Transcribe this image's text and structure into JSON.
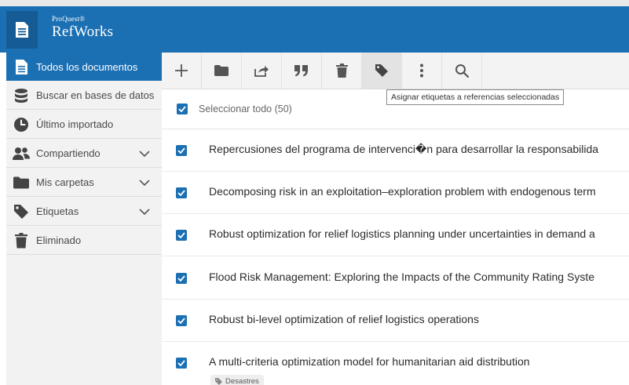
{
  "app": {
    "brand_top": "ProQuest®",
    "brand_name": "RefWorks"
  },
  "sidebar": {
    "items": [
      {
        "label": "Todos los documentos",
        "icon": "document-icon"
      },
      {
        "label": "Buscar en bases de datos",
        "icon": "database-icon"
      },
      {
        "label": "Último importado",
        "icon": "clock-icon"
      },
      {
        "label": "Compartiendo",
        "icon": "users-icon"
      },
      {
        "label": "Mis carpetas",
        "icon": "folder-icon"
      },
      {
        "label": "Etiquetas",
        "icon": "tag-icon"
      },
      {
        "label": "Eliminado",
        "icon": "trash-icon"
      }
    ]
  },
  "toolbar": {
    "buttons": [
      "plus-icon",
      "folder-icon",
      "share-icon",
      "quote-icon",
      "trash-icon",
      "tag-icon",
      "more-vertical-icon",
      "search-icon"
    ],
    "tooltip": "Asignar etiquetas a referencias seleccionadas"
  },
  "list": {
    "select_all_label": "Seleccionar todo (50)",
    "references": [
      {
        "title": "Repercusiones del programa de intervenci�n para desarrollar la responsabilida"
      },
      {
        "title": "Decomposing risk in an exploitation–exploration problem with endogenous term"
      },
      {
        "title": "Robust optimization for relief logistics planning under uncertainties in demand a"
      },
      {
        "title": "Flood Risk Management: Exploring the Impacts of the Community Rating Syste"
      },
      {
        "title": "Robust bi-level optimization of relief logistics operations"
      },
      {
        "title": "A multi-criteria optimization model for humanitarian aid distribution",
        "tag": "Desastres"
      }
    ]
  },
  "colors": {
    "primary": "#1b6fb3",
    "sidebar_bg": "#f2f2f2",
    "toolbar_bg": "#f3f3f3"
  }
}
